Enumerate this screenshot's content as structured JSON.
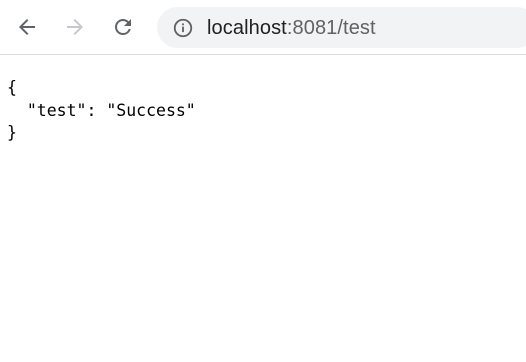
{
  "browser": {
    "back_icon": "arrow-left-icon",
    "forward_icon": "arrow-right-icon",
    "reload_icon": "reload-icon",
    "site_info_icon": "info-circle-icon",
    "url_host": "localhost",
    "url_rest": ":8081/test",
    "colors": {
      "icon_active": "#5f6368",
      "icon_disabled": "#c6c8cb",
      "omnibox_bg": "#f1f3f4"
    }
  },
  "page": {
    "lines": [
      "{",
      "  \"test\": \"Success\"",
      "}"
    ]
  }
}
